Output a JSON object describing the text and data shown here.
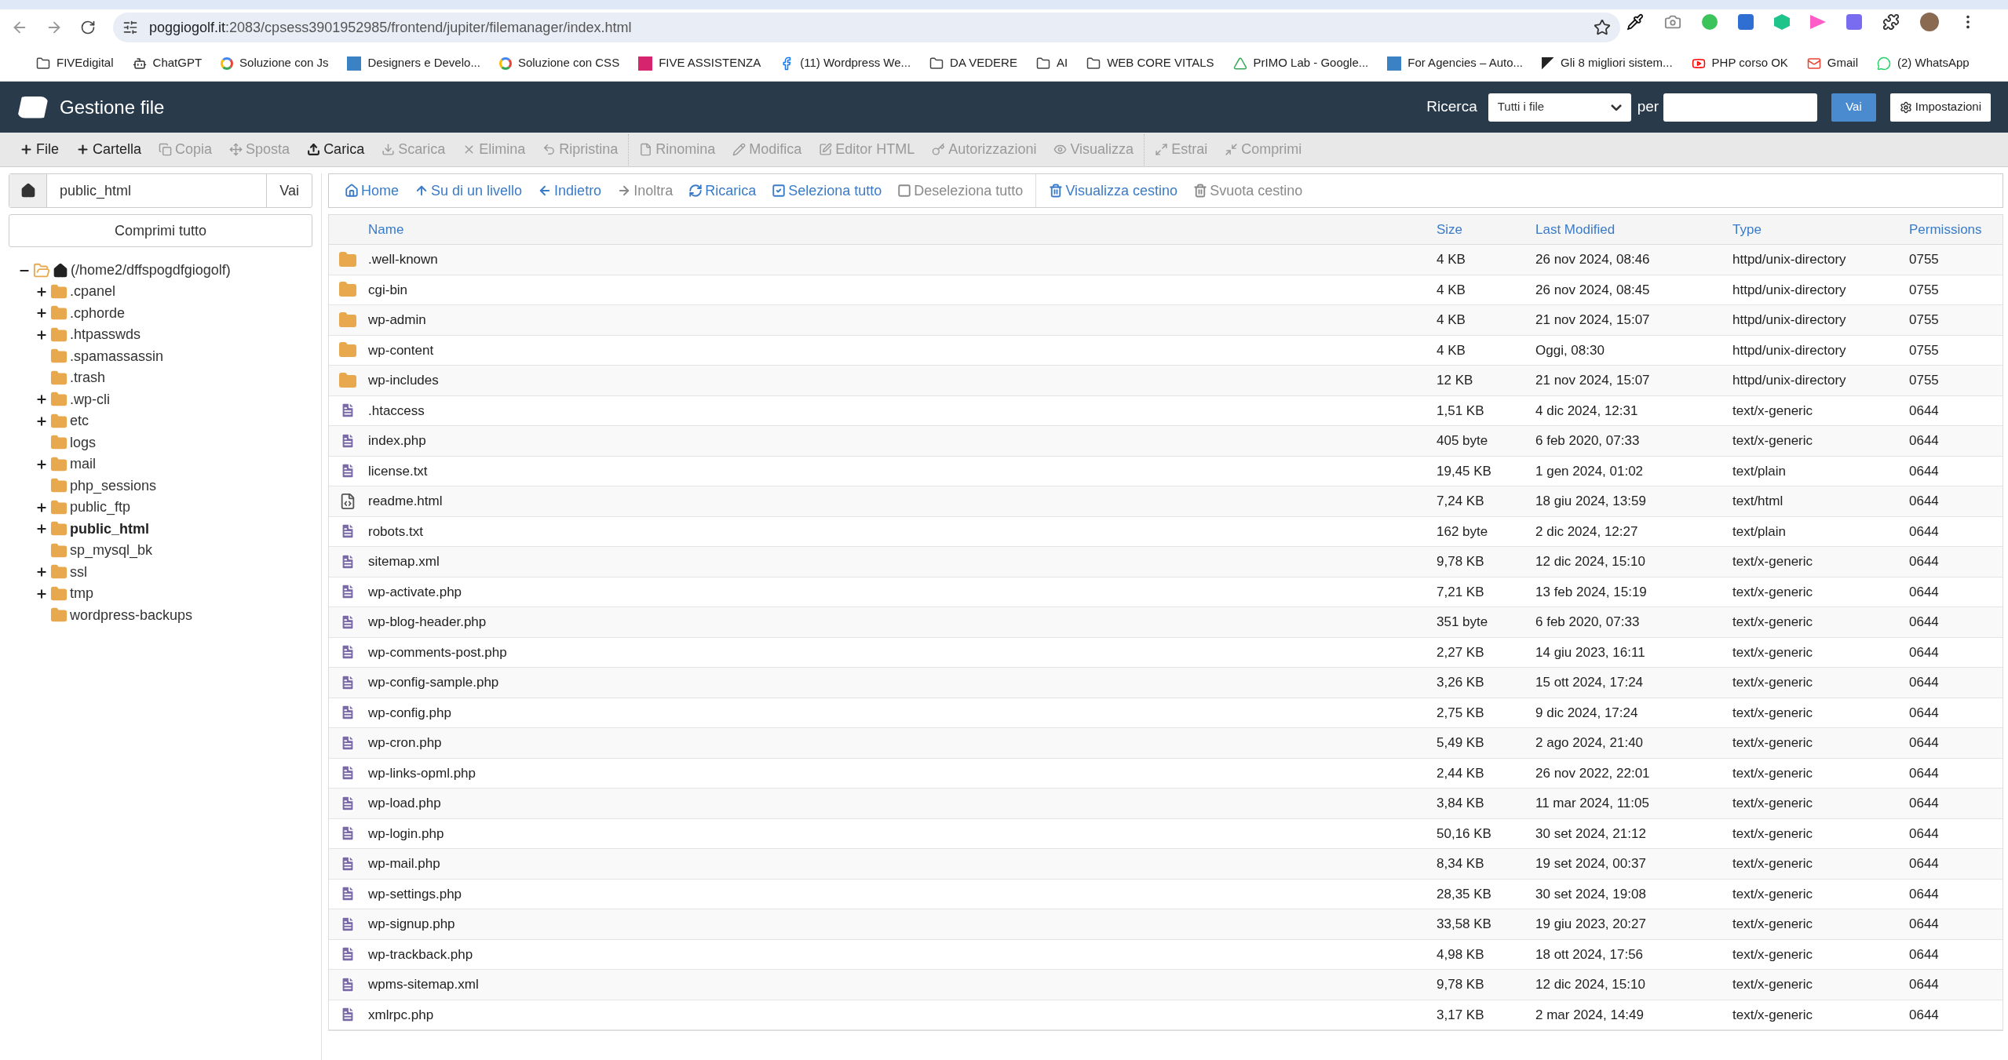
{
  "browser": {
    "url_host": "poggiogolf.it",
    "url_path": ":2083/cpsess3901952985/frontend/jupiter/filemanager/index.html",
    "bookmarks": [
      {
        "label": "FIVEdigital",
        "kind": "folder"
      },
      {
        "label": "ChatGPT",
        "kind": "chatgpt"
      },
      {
        "label": "Soluzione con Js",
        "kind": "google"
      },
      {
        "label": "Designers e Develo...",
        "kind": "letter-a"
      },
      {
        "label": "Soluzione con CSS",
        "kind": "google"
      },
      {
        "label": "FIVE ASSISTENZA",
        "kind": "five"
      },
      {
        "label": "(11) Wordpress We...",
        "kind": "facebook"
      },
      {
        "label": "DA VEDERE",
        "kind": "folder"
      },
      {
        "label": "AI",
        "kind": "folder"
      },
      {
        "label": "WEB CORE VITALS",
        "kind": "folder"
      },
      {
        "label": "PrIMO Lab - Google...",
        "kind": "drive"
      },
      {
        "label": "For Agencies – Auto...",
        "kind": "letter-a"
      },
      {
        "label": "Gli 8 migliori sistem...",
        "kind": "zendesk"
      },
      {
        "label": "PHP corso OK",
        "kind": "youtube"
      },
      {
        "label": "Gmail",
        "kind": "gmail"
      },
      {
        "label": "(2) WhatsApp",
        "kind": "whatsapp"
      }
    ]
  },
  "header": {
    "title": "Gestione file",
    "search_label": "Ricerca",
    "search_scope": "Tutti i file",
    "per_label": "per",
    "go": "Vai",
    "settings": "Impostazioni"
  },
  "toolbar": [
    {
      "label": "File",
      "kind": "plus",
      "disabled": false
    },
    {
      "label": "Cartella",
      "kind": "plus",
      "disabled": false
    },
    {
      "label": "Copia",
      "kind": "copy",
      "disabled": true
    },
    {
      "label": "Sposta",
      "kind": "move",
      "disabled": true
    },
    {
      "label": "Carica",
      "kind": "upload",
      "disabled": false
    },
    {
      "label": "Scarica",
      "kind": "download",
      "disabled": true
    },
    {
      "label": "Elimina",
      "kind": "x",
      "disabled": true
    },
    {
      "label": "Ripristina",
      "kind": "undo",
      "disabled": true
    },
    {
      "label": "Rinomina",
      "kind": "file",
      "disabled": true
    },
    {
      "label": "Modifica",
      "kind": "pencil",
      "disabled": true
    },
    {
      "label": "Editor HTML",
      "kind": "edit",
      "disabled": true
    },
    {
      "label": "Autorizzazioni",
      "kind": "key",
      "disabled": true
    },
    {
      "label": "Visualizza",
      "kind": "eye",
      "disabled": true
    },
    {
      "label": "Estrai",
      "kind": "expand",
      "disabled": true
    },
    {
      "label": "Comprimi",
      "kind": "shrink",
      "disabled": true
    }
  ],
  "path": {
    "value": "public_html",
    "go": "Vai"
  },
  "collapse_all": "Comprimi tutto",
  "tree": {
    "label": "(/home2/dffspogdfgiogolf)",
    "expanded": true,
    "children": [
      {
        "label": ".cpanel",
        "expandable": true,
        "selected": false
      },
      {
        "label": ".cphorde",
        "expandable": true,
        "selected": false
      },
      {
        "label": ".htpasswds",
        "expandable": true,
        "selected": false
      },
      {
        "label": ".spamassassin",
        "expandable": false,
        "selected": false
      },
      {
        "label": ".trash",
        "expandable": false,
        "selected": false
      },
      {
        "label": ".wp-cli",
        "expandable": true,
        "selected": false
      },
      {
        "label": "etc",
        "expandable": true,
        "selected": false
      },
      {
        "label": "logs",
        "expandable": false,
        "selected": false
      },
      {
        "label": "mail",
        "expandable": true,
        "selected": false
      },
      {
        "label": "php_sessions",
        "expandable": false,
        "selected": false
      },
      {
        "label": "public_ftp",
        "expandable": true,
        "selected": false
      },
      {
        "label": "public_html",
        "expandable": true,
        "selected": true
      },
      {
        "label": "sp_mysql_bk",
        "expandable": false,
        "selected": false
      },
      {
        "label": "ssl",
        "expandable": true,
        "selected": false
      },
      {
        "label": "tmp",
        "expandable": true,
        "selected": false
      },
      {
        "label": "wordpress-backups",
        "expandable": false,
        "selected": false
      }
    ]
  },
  "navbar": [
    {
      "label": "Home",
      "kind": "home",
      "disabled": false
    },
    {
      "label": "Su di un livello",
      "kind": "up",
      "disabled": false
    },
    {
      "label": "Indietro",
      "kind": "left",
      "disabled": false
    },
    {
      "label": "Inoltra",
      "kind": "right",
      "disabled": true
    },
    {
      "label": "Ricarica",
      "kind": "refresh",
      "disabled": false
    },
    {
      "label": "Seleziona tutto",
      "kind": "check",
      "disabled": false
    },
    {
      "label": "Deseleziona tutto",
      "kind": "square",
      "disabled": true
    },
    {
      "label": "Visualizza cestino",
      "kind": "trash",
      "disabled": false
    },
    {
      "label": "Svuota cestino",
      "kind": "trash",
      "disabled": true
    }
  ],
  "table": {
    "columns": [
      "Name",
      "Size",
      "Last Modified",
      "Type",
      "Permissions"
    ],
    "rows": [
      {
        "kind": "folder",
        "name": ".well-known",
        "size": "4 KB",
        "modified": "26 nov 2024, 08:46",
        "type": "httpd/unix-directory",
        "perms": "0755"
      },
      {
        "kind": "folder",
        "name": "cgi-bin",
        "size": "4 KB",
        "modified": "26 nov 2024, 08:45",
        "type": "httpd/unix-directory",
        "perms": "0755"
      },
      {
        "kind": "folder",
        "name": "wp-admin",
        "size": "4 KB",
        "modified": "21 nov 2024, 15:07",
        "type": "httpd/unix-directory",
        "perms": "0755"
      },
      {
        "kind": "folder",
        "name": "wp-content",
        "size": "4 KB",
        "modified": "Oggi, 08:30",
        "type": "httpd/unix-directory",
        "perms": "0755"
      },
      {
        "kind": "folder",
        "name": "wp-includes",
        "size": "12 KB",
        "modified": "21 nov 2024, 15:07",
        "type": "httpd/unix-directory",
        "perms": "0755"
      },
      {
        "kind": "file",
        "name": ".htaccess",
        "size": "1,51 KB",
        "modified": "4 dic 2024, 12:31",
        "type": "text/x-generic",
        "perms": "0644"
      },
      {
        "kind": "file",
        "name": "index.php",
        "size": "405 byte",
        "modified": "6 feb 2020, 07:33",
        "type": "text/x-generic",
        "perms": "0644"
      },
      {
        "kind": "file",
        "name": "license.txt",
        "size": "19,45 KB",
        "modified": "1 gen 2024, 01:02",
        "type": "text/plain",
        "perms": "0644"
      },
      {
        "kind": "html",
        "name": "readme.html",
        "size": "7,24 KB",
        "modified": "18 giu 2024, 13:59",
        "type": "text/html",
        "perms": "0644"
      },
      {
        "kind": "file",
        "name": "robots.txt",
        "size": "162 byte",
        "modified": "2 dic 2024, 12:27",
        "type": "text/plain",
        "perms": "0644"
      },
      {
        "kind": "file",
        "name": "sitemap.xml",
        "size": "9,78 KB",
        "modified": "12 dic 2024, 15:10",
        "type": "text/x-generic",
        "perms": "0644"
      },
      {
        "kind": "file",
        "name": "wp-activate.php",
        "size": "7,21 KB",
        "modified": "13 feb 2024, 15:19",
        "type": "text/x-generic",
        "perms": "0644"
      },
      {
        "kind": "file",
        "name": "wp-blog-header.php",
        "size": "351 byte",
        "modified": "6 feb 2020, 07:33",
        "type": "text/x-generic",
        "perms": "0644"
      },
      {
        "kind": "file",
        "name": "wp-comments-post.php",
        "size": "2,27 KB",
        "modified": "14 giu 2023, 16:11",
        "type": "text/x-generic",
        "perms": "0644"
      },
      {
        "kind": "file",
        "name": "wp-config-sample.php",
        "size": "3,26 KB",
        "modified": "15 ott 2024, 17:24",
        "type": "text/x-generic",
        "perms": "0644"
      },
      {
        "kind": "file",
        "name": "wp-config.php",
        "size": "2,75 KB",
        "modified": "9 dic 2024, 17:24",
        "type": "text/x-generic",
        "perms": "0644"
      },
      {
        "kind": "file",
        "name": "wp-cron.php",
        "size": "5,49 KB",
        "modified": "2 ago 2024, 21:40",
        "type": "text/x-generic",
        "perms": "0644"
      },
      {
        "kind": "file",
        "name": "wp-links-opml.php",
        "size": "2,44 KB",
        "modified": "26 nov 2022, 22:01",
        "type": "text/x-generic",
        "perms": "0644"
      },
      {
        "kind": "file",
        "name": "wp-load.php",
        "size": "3,84 KB",
        "modified": "11 mar 2024, 11:05",
        "type": "text/x-generic",
        "perms": "0644"
      },
      {
        "kind": "file",
        "name": "wp-login.php",
        "size": "50,16 KB",
        "modified": "30 set 2024, 21:12",
        "type": "text/x-generic",
        "perms": "0644"
      },
      {
        "kind": "file",
        "name": "wp-mail.php",
        "size": "8,34 KB",
        "modified": "19 set 2024, 00:37",
        "type": "text/x-generic",
        "perms": "0644"
      },
      {
        "kind": "file",
        "name": "wp-settings.php",
        "size": "28,35 KB",
        "modified": "30 set 2024, 19:08",
        "type": "text/x-generic",
        "perms": "0644"
      },
      {
        "kind": "file",
        "name": "wp-signup.php",
        "size": "33,58 KB",
        "modified": "19 giu 2023, 20:27",
        "type": "text/x-generic",
        "perms": "0644"
      },
      {
        "kind": "file",
        "name": "wp-trackback.php",
        "size": "4,98 KB",
        "modified": "18 ott 2024, 17:56",
        "type": "text/x-generic",
        "perms": "0644"
      },
      {
        "kind": "file",
        "name": "wpms-sitemap.xml",
        "size": "9,78 KB",
        "modified": "12 dic 2024, 15:10",
        "type": "text/x-generic",
        "perms": "0644"
      },
      {
        "kind": "file",
        "name": "xmlrpc.php",
        "size": "3,17 KB",
        "modified": "2 mar 2024, 14:49",
        "type": "text/x-generic",
        "perms": "0644"
      }
    ]
  }
}
